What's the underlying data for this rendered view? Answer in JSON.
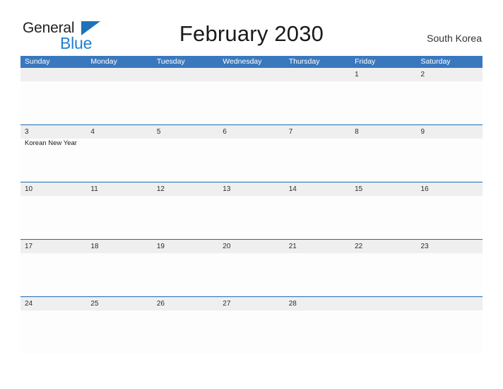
{
  "brand": {
    "name_part1": "General",
    "name_part2": "Blue",
    "triangle_icon": "triangle-icon",
    "color_dark": "#231f20",
    "color_blue": "#1f7fd0"
  },
  "header": {
    "title": "February 2030",
    "region": "South Korea"
  },
  "calendar": {
    "accent_header_color": "#3a78bd",
    "row_divider_color": "#1f6cb0",
    "date_strip_color": "#efefef",
    "weekdays": [
      "Sunday",
      "Monday",
      "Tuesday",
      "Wednesday",
      "Thursday",
      "Friday",
      "Saturday"
    ],
    "weeks": [
      [
        {
          "day": "",
          "event": ""
        },
        {
          "day": "",
          "event": ""
        },
        {
          "day": "",
          "event": ""
        },
        {
          "day": "",
          "event": ""
        },
        {
          "day": "",
          "event": ""
        },
        {
          "day": "1",
          "event": ""
        },
        {
          "day": "2",
          "event": ""
        }
      ],
      [
        {
          "day": "3",
          "event": "Korean New Year"
        },
        {
          "day": "4",
          "event": ""
        },
        {
          "day": "5",
          "event": ""
        },
        {
          "day": "6",
          "event": ""
        },
        {
          "day": "7",
          "event": ""
        },
        {
          "day": "8",
          "event": ""
        },
        {
          "day": "9",
          "event": ""
        }
      ],
      [
        {
          "day": "10",
          "event": ""
        },
        {
          "day": "11",
          "event": ""
        },
        {
          "day": "12",
          "event": ""
        },
        {
          "day": "13",
          "event": ""
        },
        {
          "day": "14",
          "event": ""
        },
        {
          "day": "15",
          "event": ""
        },
        {
          "day": "16",
          "event": ""
        }
      ],
      [
        {
          "day": "17",
          "event": ""
        },
        {
          "day": "18",
          "event": ""
        },
        {
          "day": "19",
          "event": ""
        },
        {
          "day": "20",
          "event": ""
        },
        {
          "day": "21",
          "event": ""
        },
        {
          "day": "22",
          "event": ""
        },
        {
          "day": "23",
          "event": ""
        }
      ],
      [
        {
          "day": "24",
          "event": ""
        },
        {
          "day": "25",
          "event": ""
        },
        {
          "day": "26",
          "event": ""
        },
        {
          "day": "27",
          "event": ""
        },
        {
          "day": "28",
          "event": ""
        },
        {
          "day": "",
          "event": ""
        },
        {
          "day": "",
          "event": ""
        }
      ]
    ]
  }
}
